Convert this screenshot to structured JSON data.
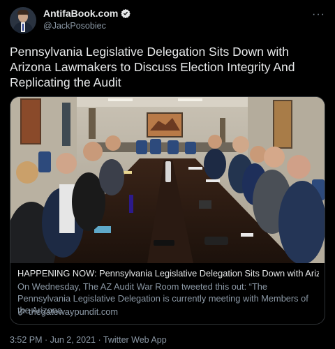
{
  "author": {
    "display_name": "AntifaBook.com",
    "handle": "@JackPosobiec",
    "verified": true,
    "avatar_icon": "profile-avatar"
  },
  "more_icon": "ellipsis-icon",
  "tweet_text": "Pennsylvania Legislative Delegation Sits Down with Arizona Lawmakers to Discuss Election Integrity And Replicating the Audit",
  "link_card": {
    "title": "HAPPENING NOW: Pennsylvania Legislative Delegation Sits Down with Arizo...",
    "description": "On Wednesday, The AZ Audit War Room tweeted this out: “The Pennsylvania Legislative Delegation is currently meeting with Members of the Arizona ...",
    "domain": "thegatewaypundit.com",
    "link_icon": "link-icon"
  },
  "timestamp": "3:52 PM · Jun 2, 2021 · Twitter Web App",
  "colors": {
    "background": "#000000",
    "text": "#e7e9ea",
    "muted": "#8b98a5",
    "verified": "#e7e9ea",
    "border": "#2f3336"
  }
}
